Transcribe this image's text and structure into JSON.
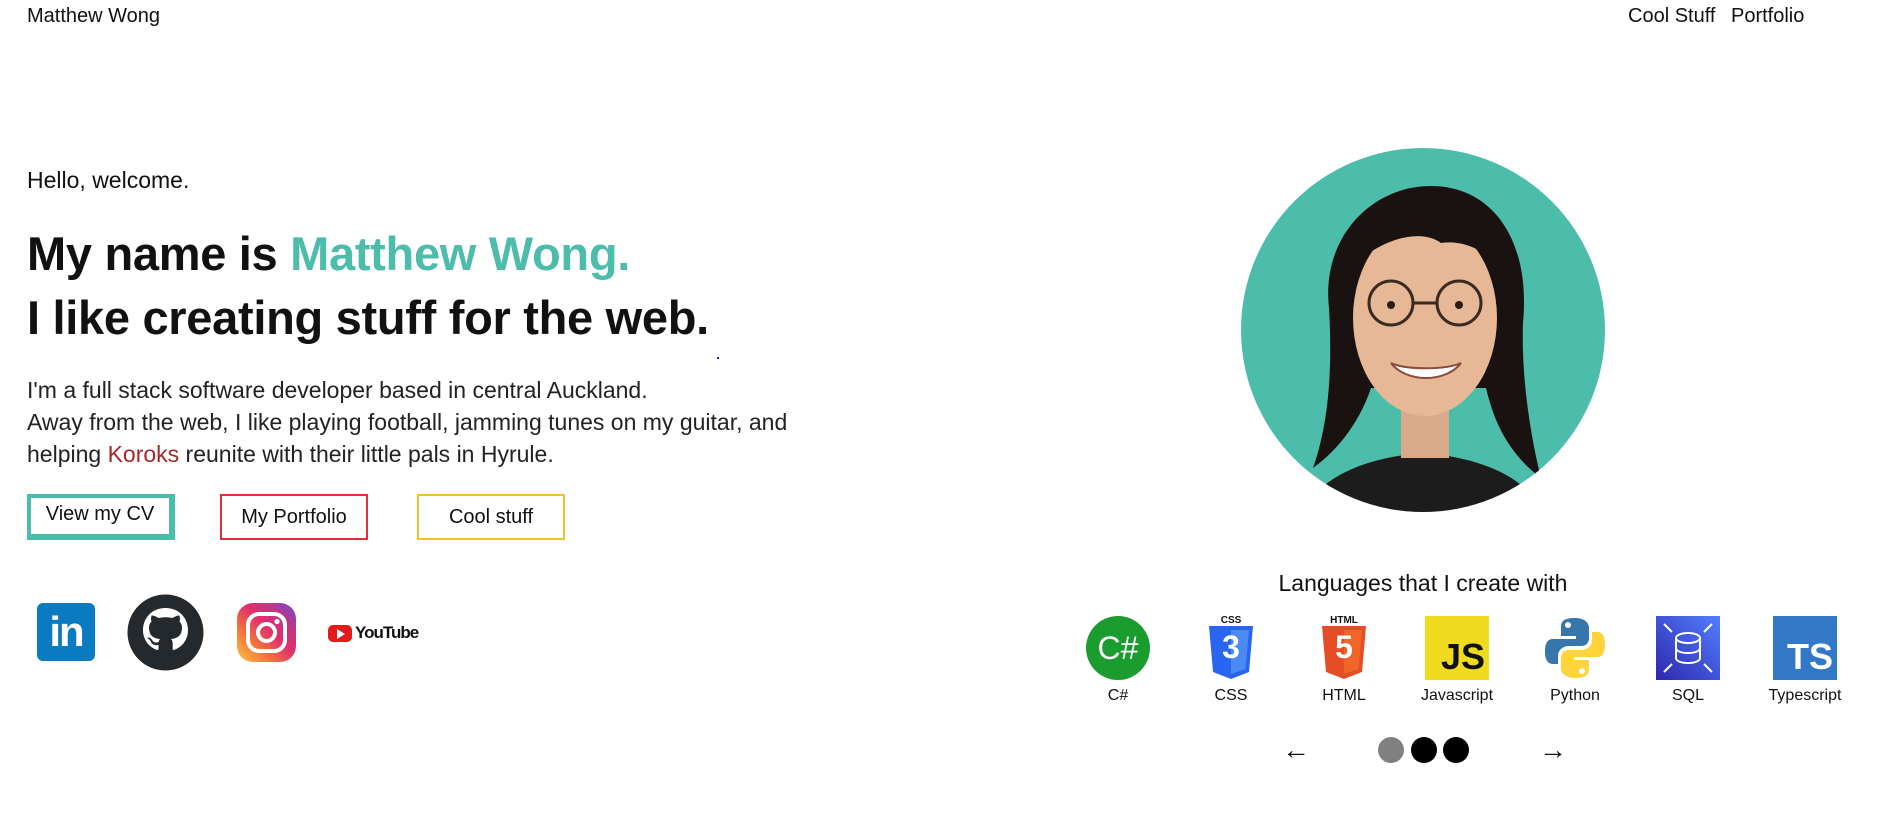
{
  "header": {
    "brand": "Matthew Wong",
    "nav": [
      {
        "label": "Cool Stuff"
      },
      {
        "label": "Portfolio"
      }
    ]
  },
  "hero": {
    "greeting": "Hello, welcome.",
    "headline_prefix": "My name is ",
    "headline_name": "Matthew Wong.",
    "headline_line2": "I like creating stuff for the web.",
    "bio_line1": "I'm a full stack software developer based in central Auckland.",
    "bio_line2": "Away from the web, I like playing football, jamming tunes on my guitar, and",
    "bio_line3_before": "helping ",
    "bio_line3_link": "Koroks",
    "bio_line3_after": " reunite with their little pals in Hyrule.",
    "buttons": [
      {
        "label": "View my CV"
      },
      {
        "label": "My Portfolio"
      },
      {
        "label": "Cool stuff"
      }
    ]
  },
  "social": {
    "linkedin_text": "in",
    "youtube_text": "YouTube",
    "icons": [
      "linkedin-icon",
      "github-icon",
      "instagram-icon",
      "youtube-icon"
    ]
  },
  "languages": {
    "title": "Languages that I create with",
    "items": [
      {
        "label": "C#",
        "icon_text": "C#",
        "color": "#1b9c2e"
      },
      {
        "label": "CSS",
        "icon_text": "3",
        "badge": "CSS",
        "color": "#2965f1"
      },
      {
        "label": "HTML",
        "icon_text": "5",
        "badge": "HTML",
        "color": "#e44d26"
      },
      {
        "label": "Javascript",
        "icon_text": "JS",
        "color": "#f0db1e"
      },
      {
        "label": "Python",
        "icon_text": "",
        "color": "#3776ab"
      },
      {
        "label": "SQL",
        "icon_text": "",
        "color": "#3b4fd6"
      },
      {
        "label": "Typescript",
        "icon_text": "TS",
        "color": "#3178c6"
      }
    ]
  },
  "carousel": {
    "prev": "←",
    "next": "→",
    "active_index": 0,
    "dot_count": 3
  },
  "colors": {
    "accent": "#4dbdab",
    "koroks": "#a82626",
    "cv_border": "#4dbdab",
    "portfolio_border": "#e0303c",
    "cool_border": "#f0c030"
  }
}
